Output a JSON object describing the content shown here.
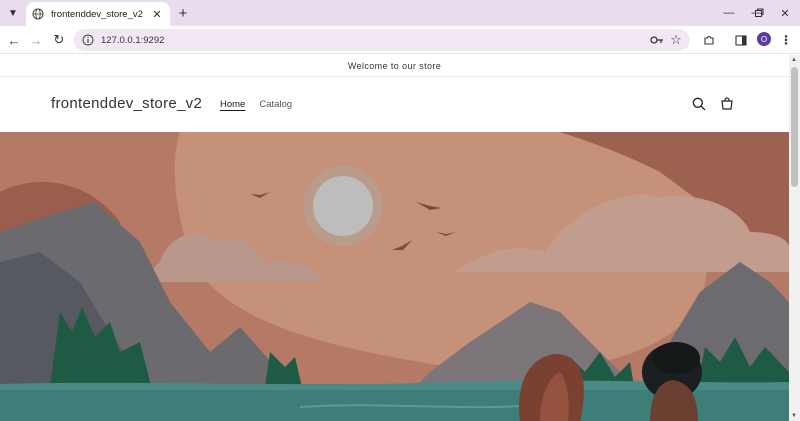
{
  "browser": {
    "tab_title": "frontenddev_store_v2",
    "url": "127.0.0.1:9292",
    "profile_initial": "O",
    "icons": [
      "tab-search-icon",
      "globe-icon",
      "close-icon",
      "new-tab-icon",
      "minimize-icon",
      "restore-icon",
      "window-close-icon",
      "back-icon",
      "forward-icon",
      "reload-icon",
      "site-info-icon",
      "password-key-icon",
      "bookmark-star-icon",
      "extensions-icon",
      "sidebar-icon",
      "menu-dots-icon"
    ]
  },
  "store": {
    "announcement": "Welcome to our store",
    "logo": "frontenddev_store_v2",
    "nav": [
      {
        "label": "Home",
        "active": true
      },
      {
        "label": "Catalog",
        "active": false
      }
    ],
    "icons": [
      "search-icon",
      "cart-icon"
    ]
  },
  "hero": {
    "colors": {
      "sky": "#b47a66",
      "sun": "#b9b9b9",
      "mountain": "#6b6b6f",
      "water": "#3f7d79",
      "trees": "#1f5a45"
    }
  }
}
